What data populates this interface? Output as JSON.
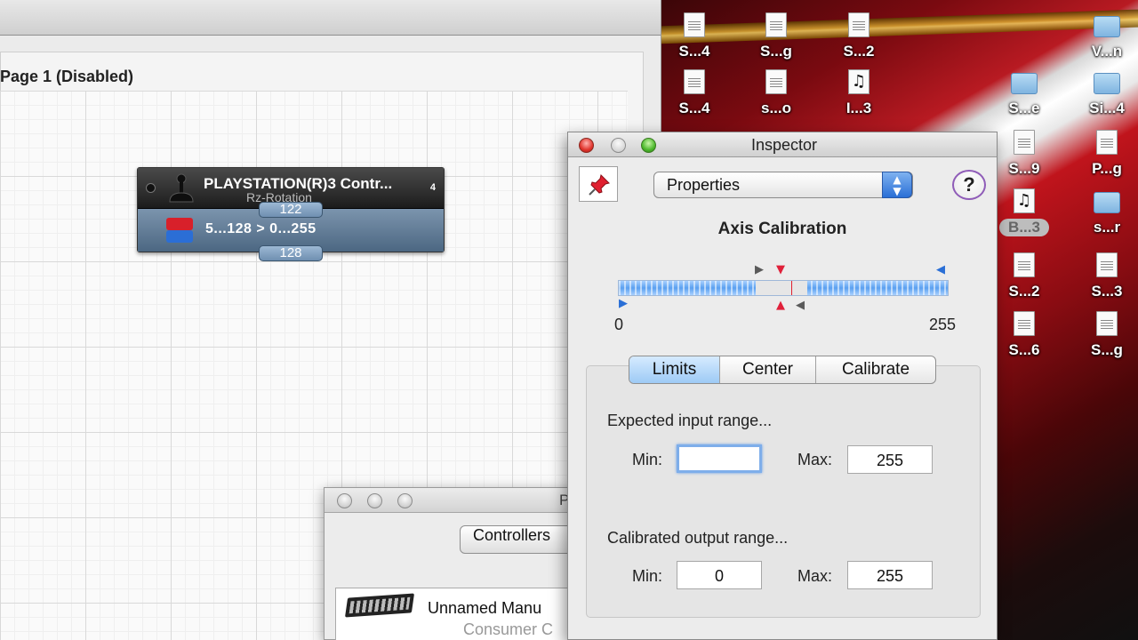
{
  "editor": {
    "page_title": "Page 1 (Disabled)",
    "node": {
      "title": "PLAYSTATION(R)3 Contr...",
      "subtitle": "Rz-Rotation",
      "count": "4",
      "mapping": "5...128  >  0...255",
      "input_value": "122",
      "output_value": "128"
    }
  },
  "desktop": {
    "icons": [
      {
        "label": "S...4",
        "icon": "document-icon"
      },
      {
        "label": "S...g",
        "icon": "document-icon"
      },
      {
        "label": "S...2",
        "icon": "document-icon"
      },
      {
        "label": "V...n",
        "icon": "folder-icon"
      },
      {
        "label": "S...4",
        "icon": "document-icon"
      },
      {
        "label": "s...o",
        "icon": "document-icon"
      },
      {
        "label": "I...3",
        "icon": "music-icon"
      },
      {
        "label": "S...e",
        "icon": "folder-icon"
      },
      {
        "label": "Si...4",
        "icon": "folder-icon"
      },
      {
        "label": "S...9",
        "icon": "document-icon"
      },
      {
        "label": "P...g",
        "icon": "document-icon"
      },
      {
        "label": "B...3",
        "icon": "music-icon"
      },
      {
        "label": "s...r",
        "icon": "folder-icon"
      },
      {
        "label": "S...2",
        "icon": "document-icon"
      },
      {
        "label": "S...3",
        "icon": "document-icon"
      },
      {
        "label": "S...6",
        "icon": "document-icon"
      },
      {
        "label": "S...g",
        "icon": "document-icon"
      }
    ]
  },
  "back_window": {
    "title_fragment": "P",
    "controllers_button": "Controllers",
    "device_name": "Unnamed Manu",
    "device_sub": "Consumer C"
  },
  "inspector": {
    "title": "Inspector",
    "popup_value": "Properties",
    "help_label": "?",
    "section_title": "Axis Calibration",
    "range_min_label": "0",
    "range_max_label": "255",
    "tabs": [
      "Limits",
      "Center",
      "Calibrate"
    ],
    "active_tab": "Limits",
    "expected_input_label": "Expected input range...",
    "input_min_label": "Min:",
    "input_min_value": "",
    "input_max_label": "Max:",
    "input_max_value": "255",
    "output_label": "Calibrated output range...",
    "output_min_label": "Min:",
    "output_min_value": "0",
    "output_max_label": "Max:",
    "output_max_value": "255"
  },
  "colors": {
    "node_row": "#4c6782",
    "accent_blue": "#2a6fd6",
    "marker_red": "#e0203a"
  }
}
